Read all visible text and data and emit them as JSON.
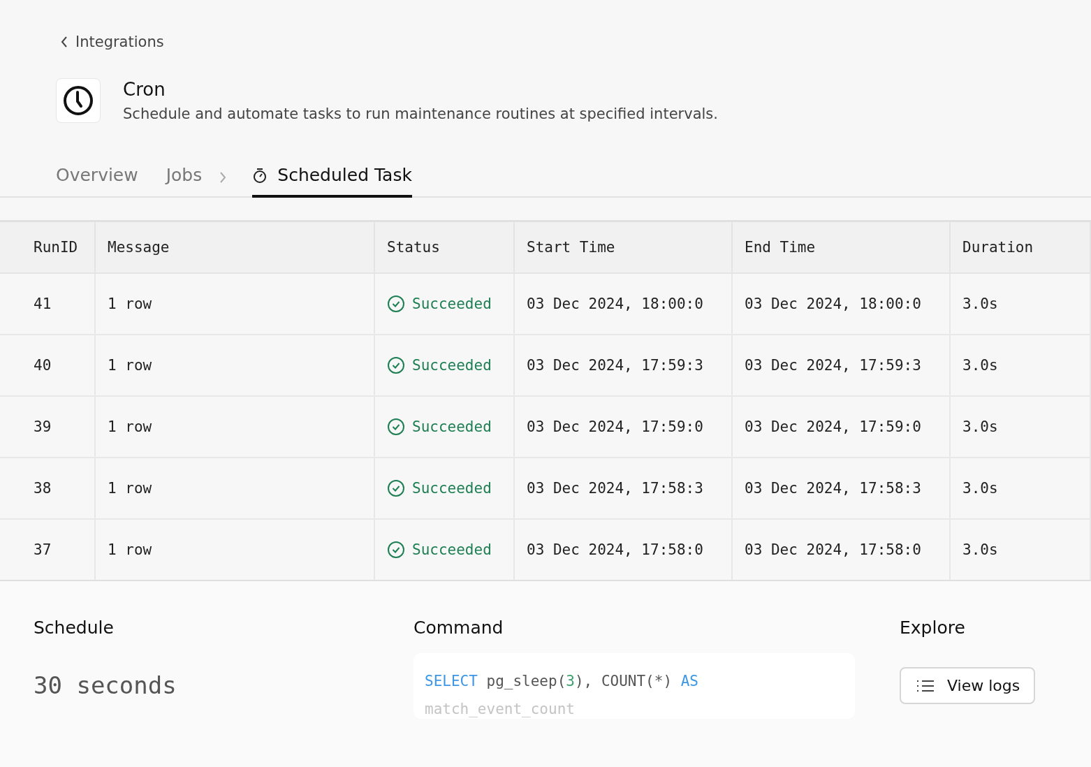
{
  "back_link": {
    "label": "Integrations"
  },
  "integration": {
    "name": "Cron",
    "description": "Schedule and automate tasks to run maintenance routines at specified intervals."
  },
  "tabs": [
    {
      "label": "Overview",
      "selected": false,
      "kind": "tab"
    },
    {
      "label": "Jobs",
      "selected": false,
      "kind": "crumb"
    },
    {
      "label": "Scheduled Task",
      "selected": true,
      "kind": "timer"
    }
  ],
  "table": {
    "columns": [
      "RunID",
      "Message",
      "Status",
      "Start Time",
      "End Time",
      "Duration"
    ],
    "rows": [
      {
        "run_id": "41",
        "message": "1 row",
        "status": "Succeeded",
        "start": "03 Dec 2024, 18:00:0",
        "end": "03 Dec 2024, 18:00:0",
        "duration": "3.0s"
      },
      {
        "run_id": "40",
        "message": "1 row",
        "status": "Succeeded",
        "start": "03 Dec 2024, 17:59:3",
        "end": "03 Dec 2024, 17:59:3",
        "duration": "3.0s"
      },
      {
        "run_id": "39",
        "message": "1 row",
        "status": "Succeeded",
        "start": "03 Dec 2024, 17:59:0",
        "end": "03 Dec 2024, 17:59:0",
        "duration": "3.0s"
      },
      {
        "run_id": "38",
        "message": "1 row",
        "status": "Succeeded",
        "start": "03 Dec 2024, 17:58:3",
        "end": "03 Dec 2024, 17:58:3",
        "duration": "3.0s"
      },
      {
        "run_id": "37",
        "message": "1 row",
        "status": "Succeeded",
        "start": "03 Dec 2024, 17:58:0",
        "end": "03 Dec 2024, 17:58:0",
        "duration": "3.0s"
      }
    ]
  },
  "schedule": {
    "title": "Schedule",
    "value": "30 seconds"
  },
  "command": {
    "title": "Command",
    "lines": [
      [
        {
          "text": "SELECT",
          "kind": "keyword"
        },
        {
          "text": " pg_sleep(",
          "kind": "plain"
        },
        {
          "text": "3",
          "kind": "number"
        },
        {
          "text": "), COUNT(*) ",
          "kind": "plain"
        },
        {
          "text": "AS",
          "kind": "keyword"
        }
      ],
      [
        {
          "text": "match_event_count",
          "kind": "faded"
        }
      ]
    ]
  },
  "explore": {
    "title": "Explore",
    "button": "View logs"
  }
}
